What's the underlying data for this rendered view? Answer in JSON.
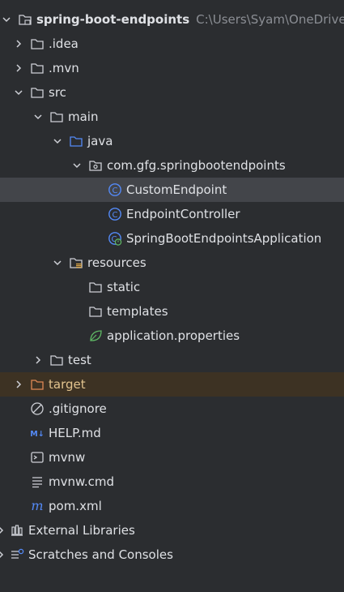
{
  "project": {
    "name": "spring-boot-endpoints",
    "path": "C:\\Users\\Syam\\OneDrive"
  },
  "tree": {
    "idea": ".idea",
    "mvn": ".mvn",
    "src": "src",
    "main": "main",
    "java": "java",
    "package": "com.gfg.springbootendpoints",
    "custom_endpoint": "CustomEndpoint",
    "endpoint_controller": "EndpointController",
    "application_class": "SpringBootEndpointsApplication",
    "resources": "resources",
    "static": "static",
    "templates": "templates",
    "app_properties": "application.properties",
    "test": "test",
    "target": "target",
    "gitignore": ".gitignore",
    "help": "HELP.md",
    "mvnw": "mvnw",
    "mvnw_cmd": "mvnw.cmd",
    "pom": "pom.xml",
    "external_libraries": "External Libraries",
    "scratches": "Scratches and Consoles"
  },
  "icons": {
    "class_glyph": "C",
    "maven_glyph": "m",
    "markdown_glyph": "M↓"
  },
  "colors": {
    "background": "#2b2d30",
    "selected_row": "#43454a",
    "excluded_row": "#3d3223",
    "excluded_text": "#e3c48f",
    "class_icon": "#548af7",
    "folder_icon": "#ced0d6",
    "source_folder_icon": "#548af7",
    "spring_icon": "#5fb865"
  }
}
